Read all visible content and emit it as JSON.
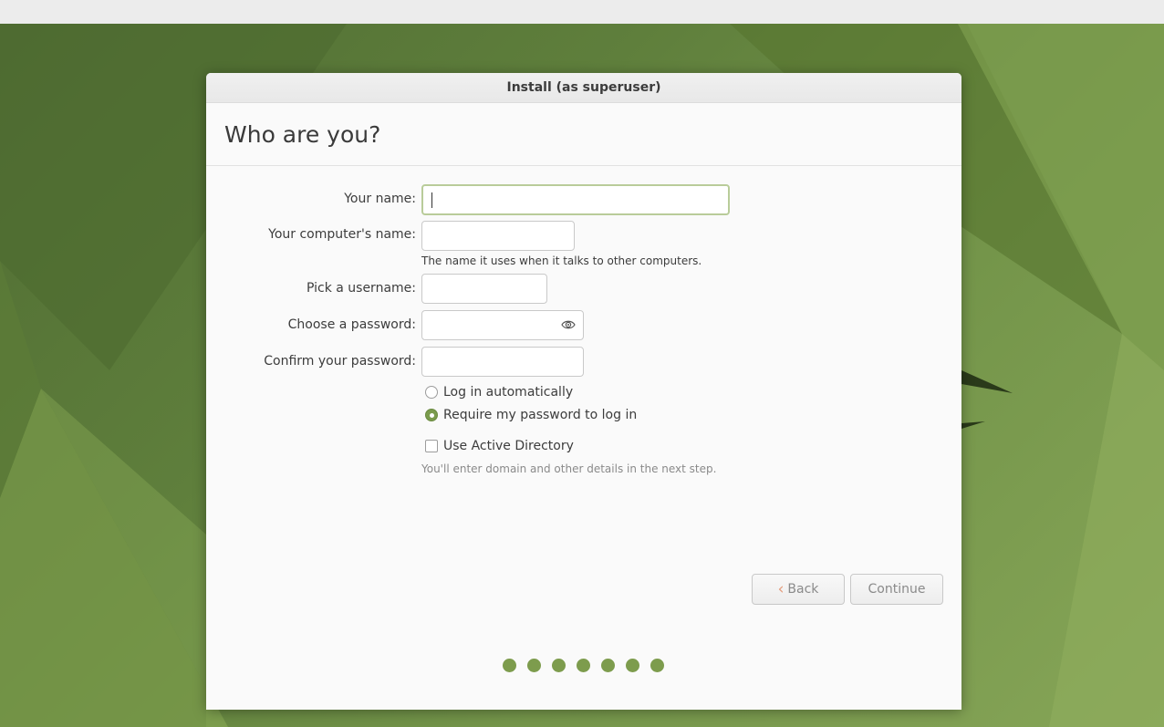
{
  "window": {
    "title": "Install (as superuser)"
  },
  "page": {
    "heading": "Who are you?"
  },
  "form": {
    "name_label": "Your name:",
    "name_value": "",
    "computer_label": "Your computer's name:",
    "computer_value": "",
    "computer_hint": "The name it uses when it talks to other computers.",
    "username_label": "Pick a username:",
    "username_value": "",
    "password_label": "Choose a password:",
    "password_value": "",
    "password_icon": "eye-icon",
    "confirm_label": "Confirm your password:",
    "confirm_value": ""
  },
  "login_options": {
    "auto_label": "Log in automatically",
    "auto_selected": false,
    "require_label": "Require my password to log in",
    "require_selected": true
  },
  "active_directory": {
    "label": "Use Active Directory",
    "checked": false,
    "hint": "You'll enter domain and other details in the next step."
  },
  "buttons": {
    "back_label": "Back",
    "back_icon": "chevron-left-icon",
    "continue_label": "Continue"
  },
  "progress": {
    "total_steps": 7
  },
  "colors": {
    "accent": "#7d9c4d",
    "focus_border": "#b9cc9a",
    "back_chevron": "#e39a79"
  }
}
